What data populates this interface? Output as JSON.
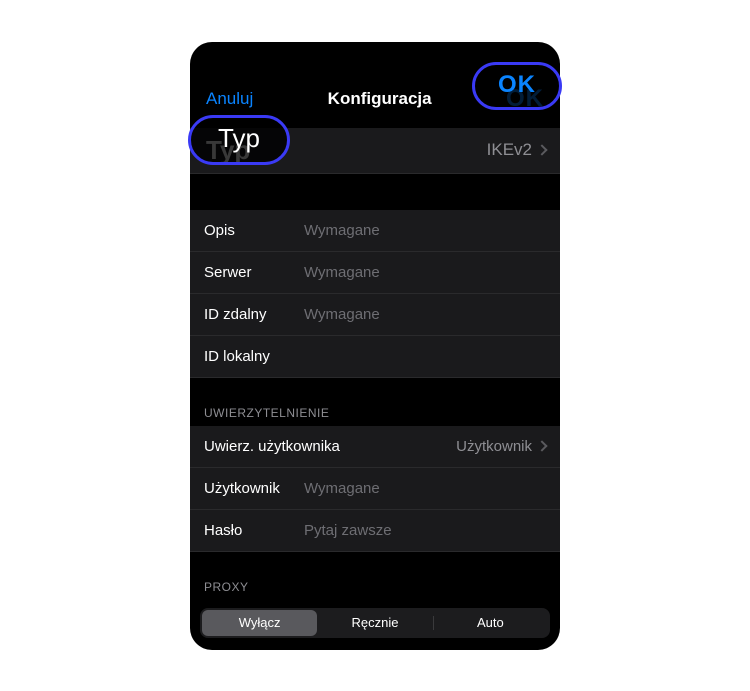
{
  "header": {
    "cancel": "Anuluj",
    "title": "Konfiguracja",
    "ok": "OK"
  },
  "type": {
    "label": "Typ",
    "value": "IKEv2"
  },
  "fields": {
    "opis": {
      "label": "Opis",
      "placeholder": "Wymagane"
    },
    "serwer": {
      "label": "Serwer",
      "placeholder": "Wymagane"
    },
    "id_zdalny": {
      "label": "ID zdalny",
      "placeholder": "Wymagane"
    },
    "id_lokalny": {
      "label": "ID lokalny",
      "placeholder": ""
    }
  },
  "auth_section": {
    "header": "UWIERZYTELNIENIE",
    "uwierz": {
      "label": "Uwierz. użytkownika",
      "value": "Użytkownik"
    },
    "uzytkownik": {
      "label": "Użytkownik",
      "placeholder": "Wymagane"
    },
    "haslo": {
      "label": "Hasło",
      "placeholder": "Pytaj zawsze"
    }
  },
  "proxy_section": {
    "header": "PROXY",
    "options": {
      "off": "Wyłącz",
      "manual": "Ręcznie",
      "auto": "Auto"
    },
    "selected": "off"
  },
  "colors": {
    "accent": "#0a84ff",
    "highlight_border": "#3a3af5",
    "bg": "#000000",
    "row_bg": "#1a1a1c",
    "secondary_text": "#8e8e93"
  }
}
